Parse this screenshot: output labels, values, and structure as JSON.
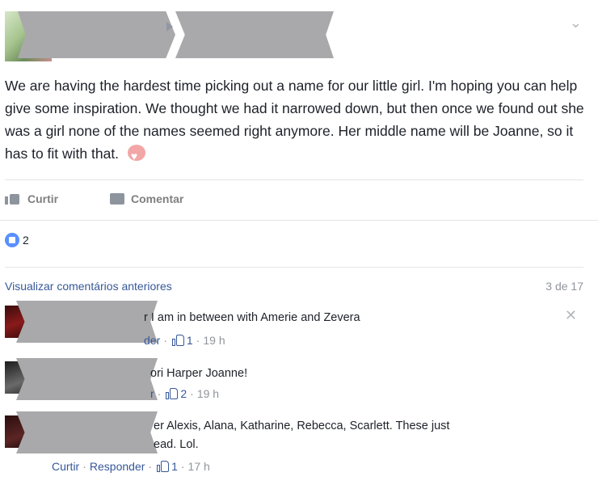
{
  "post": {
    "text": "We are having the hardest time picking out a name for our little girl. I'm hoping you can help give some inspiration. We thought we had it narrowed down, but then once we found out she was a girl none of the names seemed right anymore. Her middle name will be Joanne, so it has to fit with that."
  },
  "actions": {
    "like": "Curtir",
    "comment": "Comentar"
  },
  "likes": {
    "count": "2"
  },
  "comments_header": {
    "prev": "Visualizar comentários anteriores",
    "count": "3 de 17"
  },
  "comments": [
    {
      "text_visible": "r I am in between with Amerie and Zevera",
      "meta_reply": "der",
      "likes": "1",
      "time": "19 h"
    },
    {
      "text_visible": "ori Harper Joanne!",
      "meta_reply": "r",
      "likes": "2",
      "time": "19 h"
    },
    {
      "text_line1": "er Alexis, Alana, Katharine, Rebecca, Scarlett. These just",
      "text_line2": "ead. Lol.",
      "like_label": "Curtir",
      "reply_label": "Responder",
      "likes": "1",
      "time": "17 h"
    }
  ],
  "icons": {
    "chevron": "chevron-down-icon",
    "close": "close-icon",
    "like": "thumbs-up-icon",
    "comment": "comment-icon",
    "love": "heart-icon"
  },
  "colors": {
    "link": "#365899",
    "muted": "#90949c",
    "like_badge": "#5890ff",
    "redaction": "#a9a9ab"
  }
}
